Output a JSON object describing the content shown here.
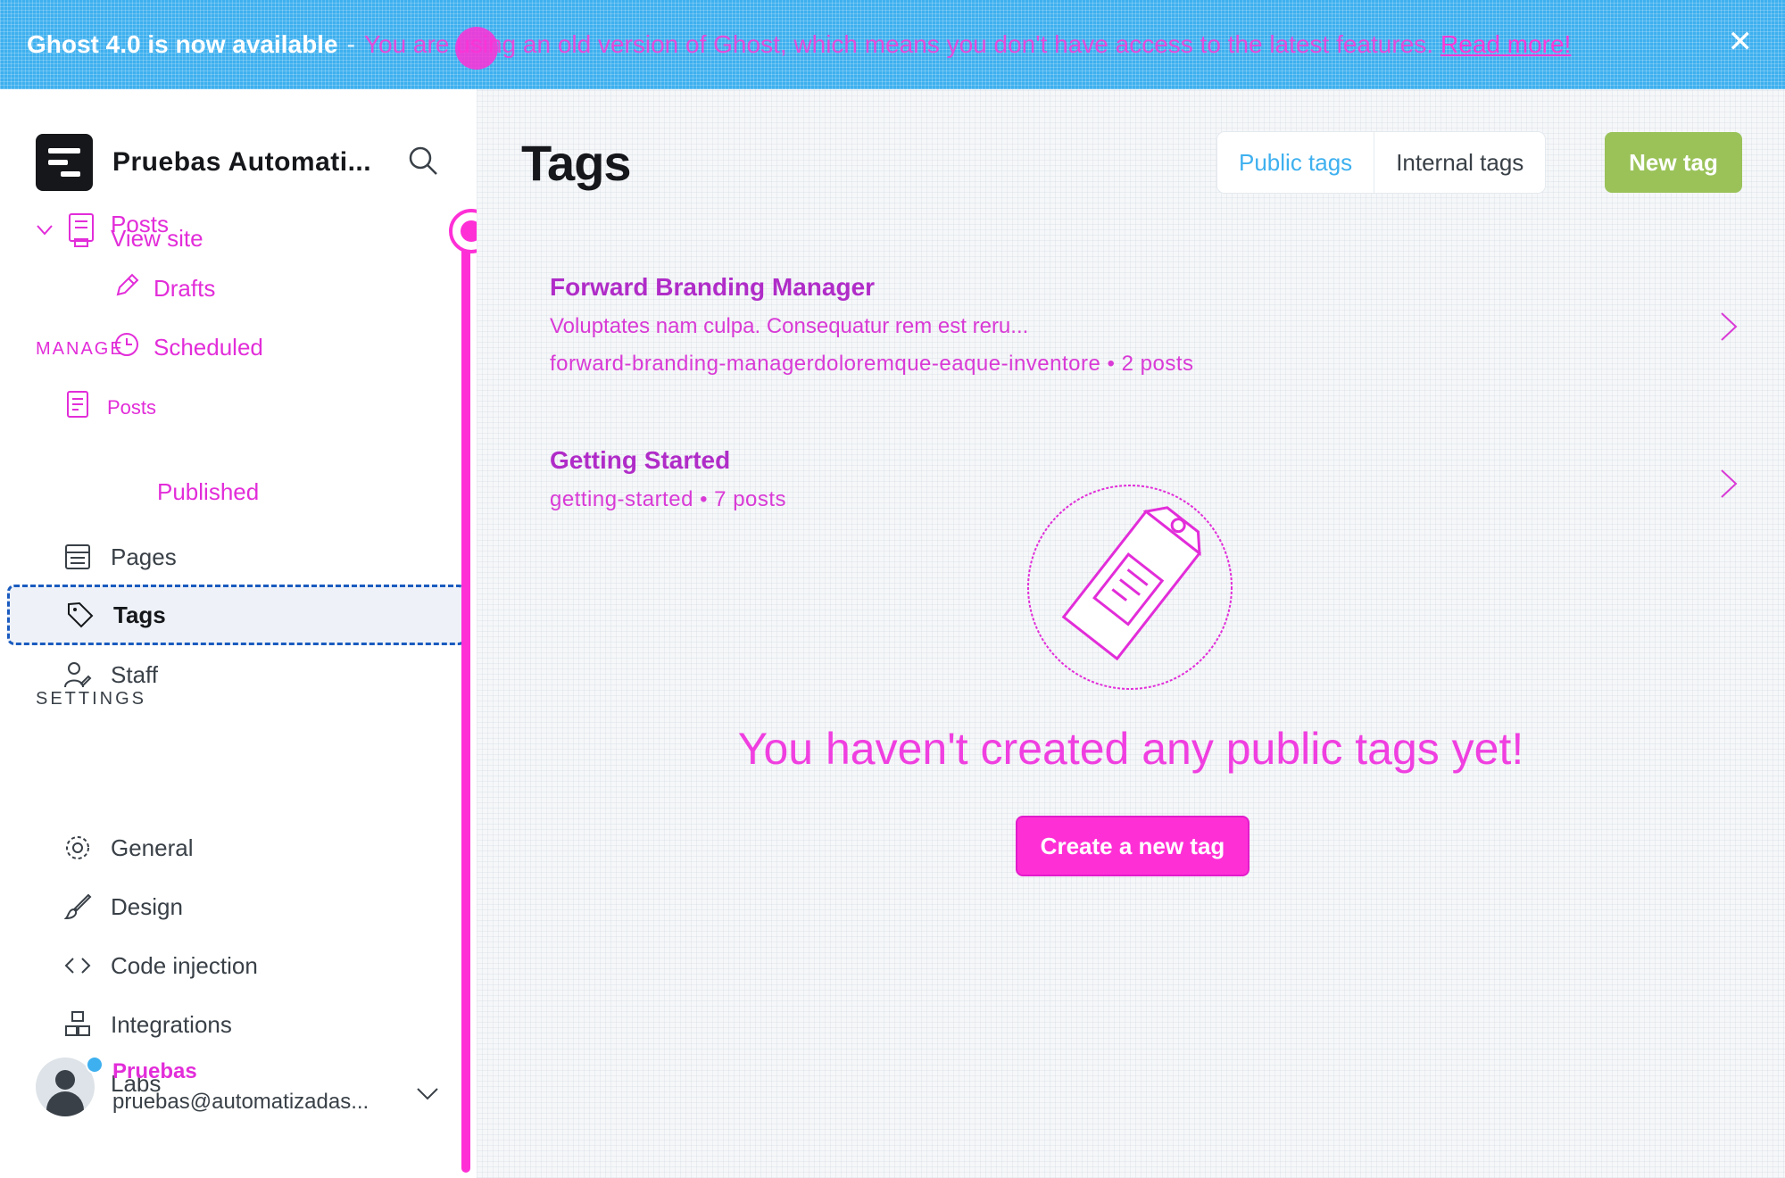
{
  "banner": {
    "title": "Ghost 4.0 is now available",
    "separator": "-",
    "message": "You are using an old version of Ghost, which means you don't have access to the latest features.",
    "link": "Read more!",
    "close_icon": "close-icon"
  },
  "brand": {
    "name": "Pruebas Automati...",
    "logo_icon": "ghost-logo-icon",
    "search_icon": "search-icon"
  },
  "nav": {
    "view_site": "View site",
    "posts_overlay": "Posts",
    "drafts": "Drafts",
    "manage_label": "MANAGE",
    "scheduled": "Scheduled",
    "posts": "Posts",
    "published": "Published",
    "pages": "Pages",
    "tags": "Tags",
    "staff": "Staff"
  },
  "settings": {
    "label": "SETTINGS",
    "general": "General",
    "design": "Design",
    "code_injection": "Code injection",
    "integrations": "Integrations",
    "labs": "Labs"
  },
  "user": {
    "name": "Pruebas",
    "email": "pruebas@automatizadas..."
  },
  "main": {
    "title": "Tags",
    "tab_public": "Public tags",
    "tab_internal": "Internal tags",
    "new_tag": "New tag",
    "tags": [
      {
        "name": "Forward Branding Manager",
        "description": "Voluptates nam culpa. Consequatur rem est reru...",
        "slug": "forward-branding-managerdoloremque-eaque-inventore",
        "count": "2 posts"
      },
      {
        "name": "Getting Started",
        "description": "",
        "slug": "getting-started",
        "count": "7 posts"
      }
    ],
    "empty_message": "You haven't created any public tags yet!",
    "create_button": "Create a new tag"
  },
  "colors": {
    "accent_blue": "#3eb0ef",
    "green": "#9ac259",
    "magenta": "#ff2fd6",
    "active_border": "#1a5bbf"
  }
}
